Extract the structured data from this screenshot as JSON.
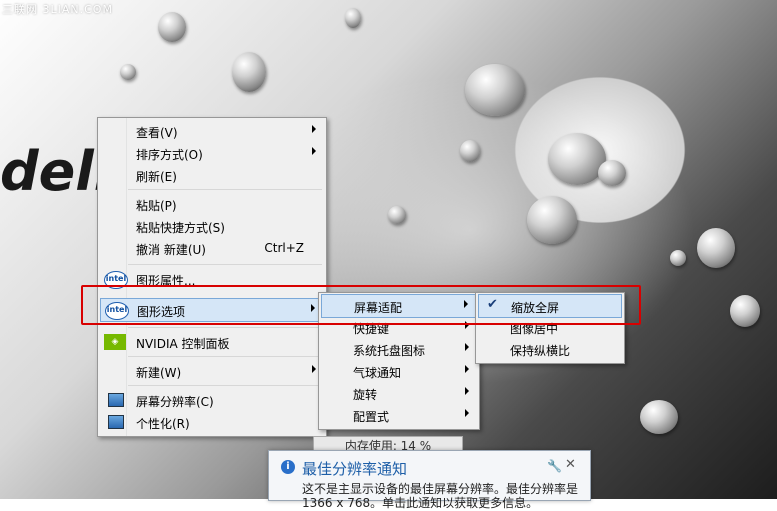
{
  "watermark": "三联网 3LIAN.COM",
  "brand_text": "dell",
  "main_menu": {
    "items": [
      {
        "label": "查看(V)",
        "submenu": true
      },
      {
        "label": "排序方式(O)",
        "submenu": true
      },
      {
        "label": "刷新(E)"
      },
      {
        "label": "粘贴(P)"
      },
      {
        "label": "粘贴快捷方式(S)"
      },
      {
        "label": "撤消 新建(U)",
        "shortcut": "Ctrl+Z"
      },
      {
        "label": "图形属性...",
        "icon": "intel-icon",
        "icon_text": "intel"
      },
      {
        "label": "图形选项",
        "icon": "intel-icon",
        "icon_text": "intel",
        "submenu": true
      },
      {
        "label": "NVIDIA 控制面板",
        "icon": "nvidia-icon",
        "icon_text": "◈"
      },
      {
        "label": "新建(W)",
        "submenu": true
      },
      {
        "label": "屏幕分辨率(C)",
        "icon": "monitor-icon"
      },
      {
        "label": "个性化(R)",
        "icon": "monitor-icon"
      }
    ]
  },
  "sub_menu": {
    "items": [
      {
        "label": "屏幕适配",
        "submenu": true
      },
      {
        "label": "快捷键",
        "submenu": true
      },
      {
        "label": "系统托盘图标",
        "submenu": true
      },
      {
        "label": "气球通知",
        "submenu": true
      },
      {
        "label": "旋转",
        "submenu": true
      },
      {
        "label": "配置式",
        "submenu": true
      }
    ]
  },
  "fit_menu": {
    "items": [
      {
        "label": "缩放全屏",
        "checked": true
      },
      {
        "label": "图像居中"
      },
      {
        "label": "保持纵横比"
      }
    ]
  },
  "memory_label": "内存使用: 14 %",
  "notification": {
    "title": "最佳分辨率通知",
    "body": "这不是主显示设备的最佳屏幕分辨率。最佳分辨率是",
    "body2": "1366 x 768。单击此通知以获取更多信息。"
  },
  "colors": {
    "highlight": "#d5e6f7",
    "frame": "#d80000",
    "notify_title": "#1e5fa8"
  }
}
